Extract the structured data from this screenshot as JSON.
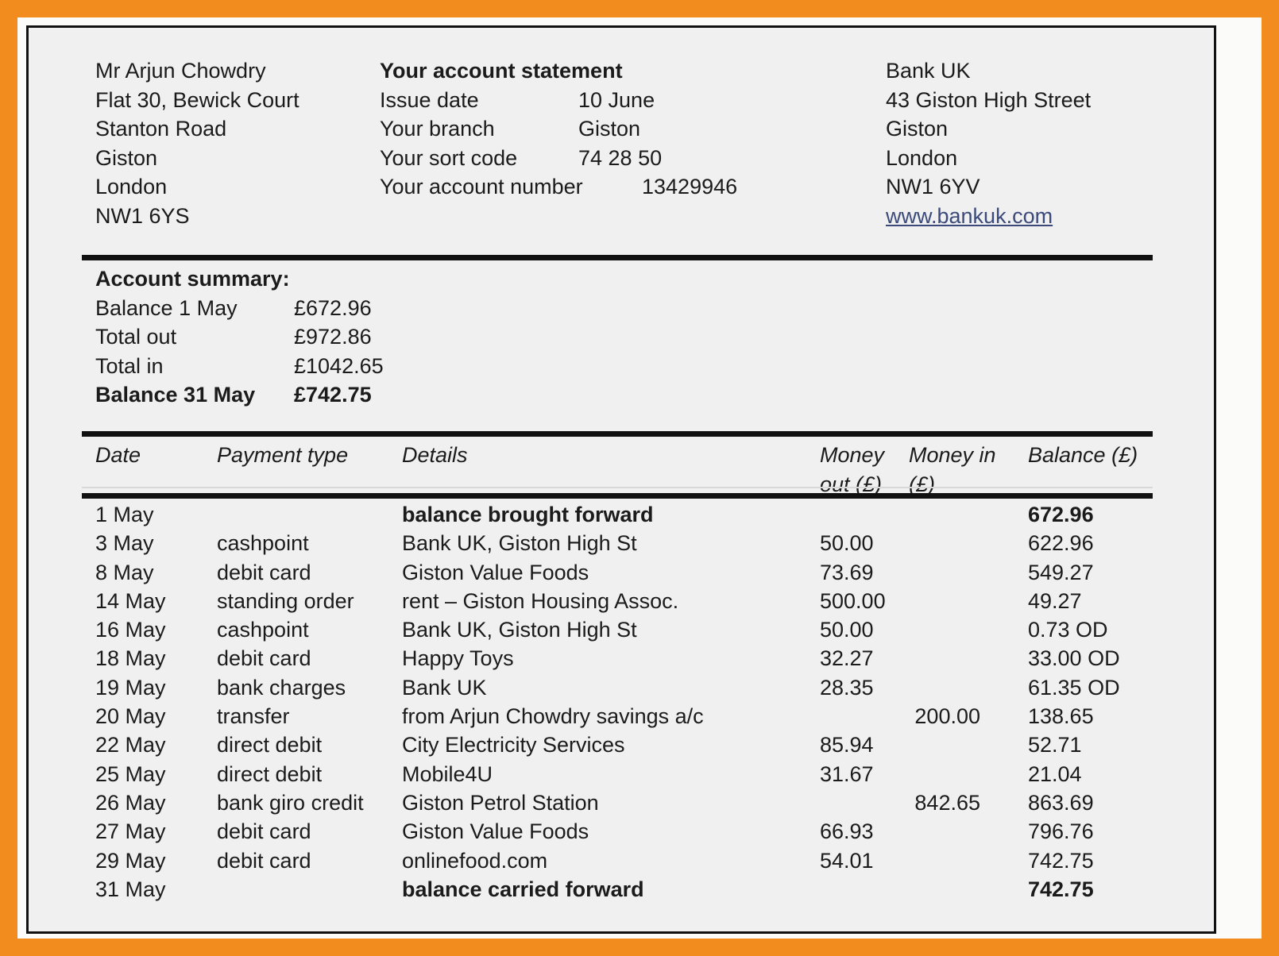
{
  "colors": {
    "border_orange": "#F28C1E",
    "page_background": "#F0F0F0",
    "rule_black": "#111111",
    "link_blue": "#3B4A7A"
  },
  "customer_address": [
    "Mr Arjun Chowdry",
    "Flat 30, Bewick Court",
    "Stanton Road",
    "Giston",
    "London",
    "NW1 6YS"
  ],
  "statement": {
    "title": "Your account statement",
    "fields": [
      {
        "label": "Issue date",
        "value": "10 June"
      },
      {
        "label": "Your branch",
        "value": "Giston"
      },
      {
        "label": "Your sort code",
        "value": "74 28 50"
      },
      {
        "label": "Your account number",
        "value": "13429946"
      }
    ]
  },
  "bank_address": {
    "lines": [
      "Bank UK",
      "43 Giston High Street",
      "Giston",
      "London",
      "NW1 6YV"
    ],
    "website": "www.bankuk.com"
  },
  "account_summary": {
    "title": "Account summary:",
    "rows": [
      {
        "label": "Balance 1 May",
        "value": "£672.96",
        "bold": false
      },
      {
        "label": "Total out",
        "value": "£972.86",
        "bold": false
      },
      {
        "label": "Total in",
        "value": "£1042.65",
        "bold": false
      },
      {
        "label": "Balance 31 May",
        "value": "£742.75",
        "bold": true
      }
    ]
  },
  "transactions": {
    "headers": {
      "date": "Date",
      "payment_type": "Payment type",
      "details": "Details",
      "money_out": "Money out (£)",
      "money_in": "Money in (£)",
      "balance": "Balance (£)"
    },
    "rows": [
      {
        "date": "1 May",
        "type": "",
        "details": "balance brought forward",
        "out": "",
        "in": "",
        "balance": "672.96",
        "bold": true
      },
      {
        "date": "3 May",
        "type": "cashpoint",
        "details": "Bank UK, Giston High St",
        "out": "50.00",
        "in": "",
        "balance": "622.96",
        "bold": false
      },
      {
        "date": "8 May",
        "type": "debit card",
        "details": "Giston Value Foods",
        "out": "73.69",
        "in": "",
        "balance": "549.27",
        "bold": false
      },
      {
        "date": "14 May",
        "type": "standing order",
        "details": "rent – Giston Housing Assoc.",
        "out": "500.00",
        "in": "",
        "balance": "49.27",
        "bold": false
      },
      {
        "date": "16 May",
        "type": "cashpoint",
        "details": "Bank UK, Giston High St",
        "out": "50.00",
        "in": "",
        "balance": "0.73 OD",
        "bold": false
      },
      {
        "date": "18 May",
        "type": "debit card",
        "details": "Happy Toys",
        "out": "32.27",
        "in": "",
        "balance": "33.00 OD",
        "bold": false
      },
      {
        "date": "19 May",
        "type": "bank charges",
        "details": "Bank UK",
        "out": "28.35",
        "in": "",
        "balance": "61.35 OD",
        "bold": false
      },
      {
        "date": "20 May",
        "type": "transfer",
        "details": "from Arjun Chowdry savings a/c",
        "out": "",
        "in": "200.00",
        "balance": "138.65",
        "bold": false
      },
      {
        "date": "22 May",
        "type": "direct debit",
        "details": "City Electricity Services",
        "out": "85.94",
        "in": "",
        "balance": "52.71",
        "bold": false
      },
      {
        "date": "25 May",
        "type": "direct debit",
        "details": "Mobile4U",
        "out": "31.67",
        "in": "",
        "balance": "21.04",
        "bold": false
      },
      {
        "date": "26 May",
        "type": "bank giro credit",
        "details": "Giston Petrol Station",
        "out": "",
        "in": "842.65",
        "balance": "863.69",
        "bold": false
      },
      {
        "date": "27 May",
        "type": "debit card",
        "details": "Giston Value Foods",
        "out": "66.93",
        "in": "",
        "balance": "796.76",
        "bold": false
      },
      {
        "date": "29 May",
        "type": "debit card",
        "details": "onlinefood.com",
        "out": "54.01",
        "in": "",
        "balance": "742.75",
        "bold": false
      },
      {
        "date": "31 May",
        "type": "",
        "details": "balance carried forward",
        "out": "",
        "in": "",
        "balance": "742.75",
        "bold": true
      }
    ]
  }
}
